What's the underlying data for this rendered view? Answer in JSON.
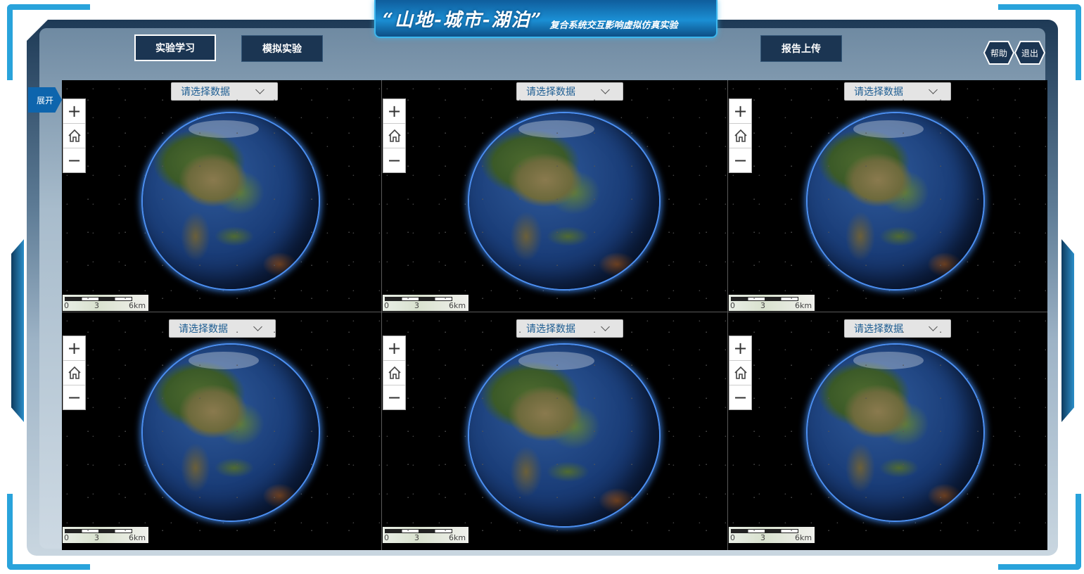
{
  "title": {
    "main": "“山地-城市-湖泊”",
    "subtitle": "复合系统交互影响虚拟仿真实验"
  },
  "nav": {
    "learn": "实验学习",
    "simulate": "模拟实验",
    "report": "报告上传"
  },
  "top_right": {
    "help": "帮助",
    "exit": "退出"
  },
  "side": {
    "expand": "展开"
  },
  "panels": [
    {
      "select_label": "请选择数据",
      "scale": [
        "0",
        "3",
        "6km"
      ]
    },
    {
      "select_label": "请选择数据",
      "scale": [
        "0",
        "3",
        "6km"
      ]
    },
    {
      "select_label": "请选择数据",
      "scale": [
        "0",
        "3",
        "6km"
      ]
    },
    {
      "select_label": "请选择数据",
      "scale": [
        "0",
        "3",
        "6km"
      ]
    },
    {
      "select_label": "请选择数据",
      "scale": [
        "0",
        "3",
        "6km"
      ]
    },
    {
      "select_label": "请选择数据",
      "scale": [
        "0",
        "3",
        "6km"
      ]
    }
  ],
  "zoom_controls": {
    "plus": "+",
    "home_icon": "home-icon",
    "minus": "−"
  },
  "colors": {
    "accent": "#29a3db",
    "nav_button": "#1b3552",
    "dropdown_text": "#1d5d92"
  }
}
